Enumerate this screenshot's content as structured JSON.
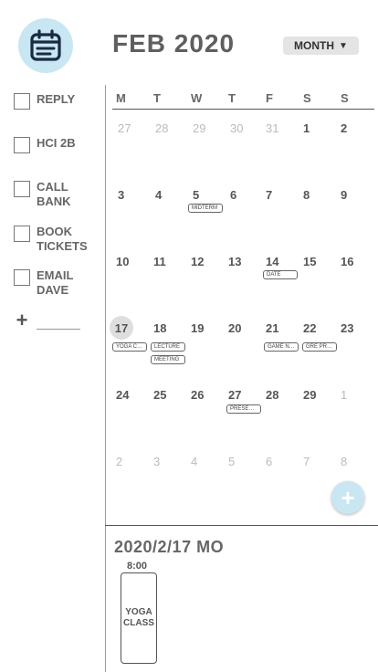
{
  "header": {
    "app_icon": "calendar-icon",
    "title": "FEB 2020",
    "view_mode": "MONTH",
    "accent_color": "#c9e6f3"
  },
  "todos": {
    "items": [
      {
        "label": "REPLY",
        "checked": false
      },
      {
        "label": "HCI 2B",
        "checked": false
      },
      {
        "label": "CALL BANK",
        "checked": false
      },
      {
        "label": "BOOK TICKETS",
        "checked": false
      },
      {
        "label": "EMAIL DAVE",
        "checked": false
      }
    ],
    "add_icon": "plus-icon",
    "add_value": ""
  },
  "calendar": {
    "weekdays": [
      "M",
      "T",
      "W",
      "T",
      "F",
      "S",
      "S"
    ],
    "weeks": [
      [
        "27",
        "28",
        "29",
        "30",
        "31",
        "1",
        "2"
      ],
      [
        "3",
        "4",
        "5",
        "6",
        "7",
        "8",
        "9"
      ],
      [
        "10",
        "11",
        "12",
        "13",
        "14",
        "15",
        "16"
      ],
      [
        "17",
        "18",
        "19",
        "20",
        "21",
        "22",
        "23"
      ],
      [
        "24",
        "25",
        "26",
        "27",
        "28",
        "29",
        "1"
      ],
      [
        "2",
        "3",
        "4",
        "5",
        "6",
        "7",
        "8"
      ]
    ],
    "today": "17",
    "events": [
      {
        "day": "5",
        "label": "MIDTERM"
      },
      {
        "day": "14",
        "label": "DATE"
      },
      {
        "day": "17",
        "label": "YOGA CLA..."
      },
      {
        "day": "18",
        "label": "LECTURE"
      },
      {
        "day": "18",
        "label": "MEETING"
      },
      {
        "day": "21",
        "label": "GAME NIG..."
      },
      {
        "day": "22",
        "label": "GRE PREP"
      },
      {
        "day": "27",
        "label": "PRESENTA..."
      }
    ],
    "fab_icon": "plus-icon"
  },
  "agenda": {
    "date": "2020/2/17 MO",
    "time": "8:00",
    "event": "YOGA CLASS"
  }
}
